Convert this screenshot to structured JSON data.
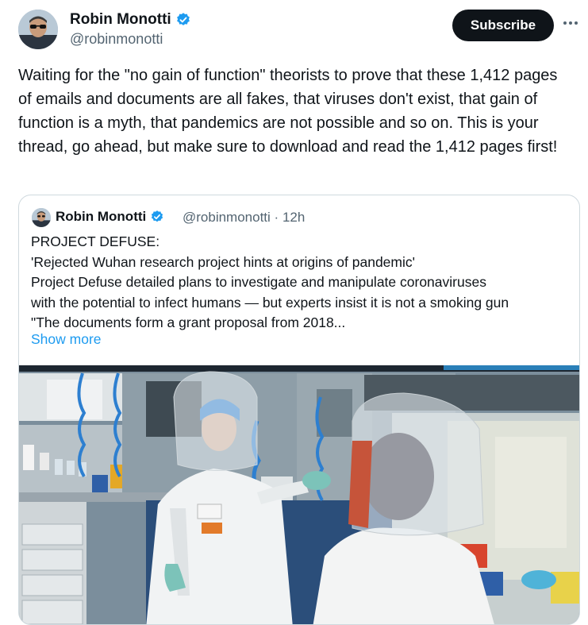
{
  "tweet": {
    "author_name": "Robin Monotti",
    "author_handle": "@robinmonotti",
    "subscribe_label": "Subscribe",
    "text": "Waiting for the \"no gain of function\" theorists to prove that these 1,412 pages of emails and documents are all fakes, that viruses don't exist, that gain of function is a myth, that pandemics are not possible and so on. This is your thread, go ahead, but make sure to download and read the 1,412 pages first!"
  },
  "quote": {
    "author_name": "Robin Monotti",
    "author_handle": "@robinmonotti",
    "separator": "·",
    "time": "12h",
    "lines": [
      "PROJECT DEFUSE:",
      "'Rejected Wuhan research project hints at origins of pandemic'",
      "Project Defuse detailed plans to investigate and manipulate coronaviruses",
      "with the potential to infect humans — but experts insist it is not a smoking gun",
      "\"The documents form a grant proposal from 2018..."
    ],
    "show_more": "Show more"
  },
  "colors": {
    "link": "#1d9bf0",
    "verified": "#1d9bf0",
    "secondary_text": "#536471",
    "border": "#cfd9de"
  },
  "icons": [
    "verified-badge-icon",
    "more-options-icon"
  ]
}
